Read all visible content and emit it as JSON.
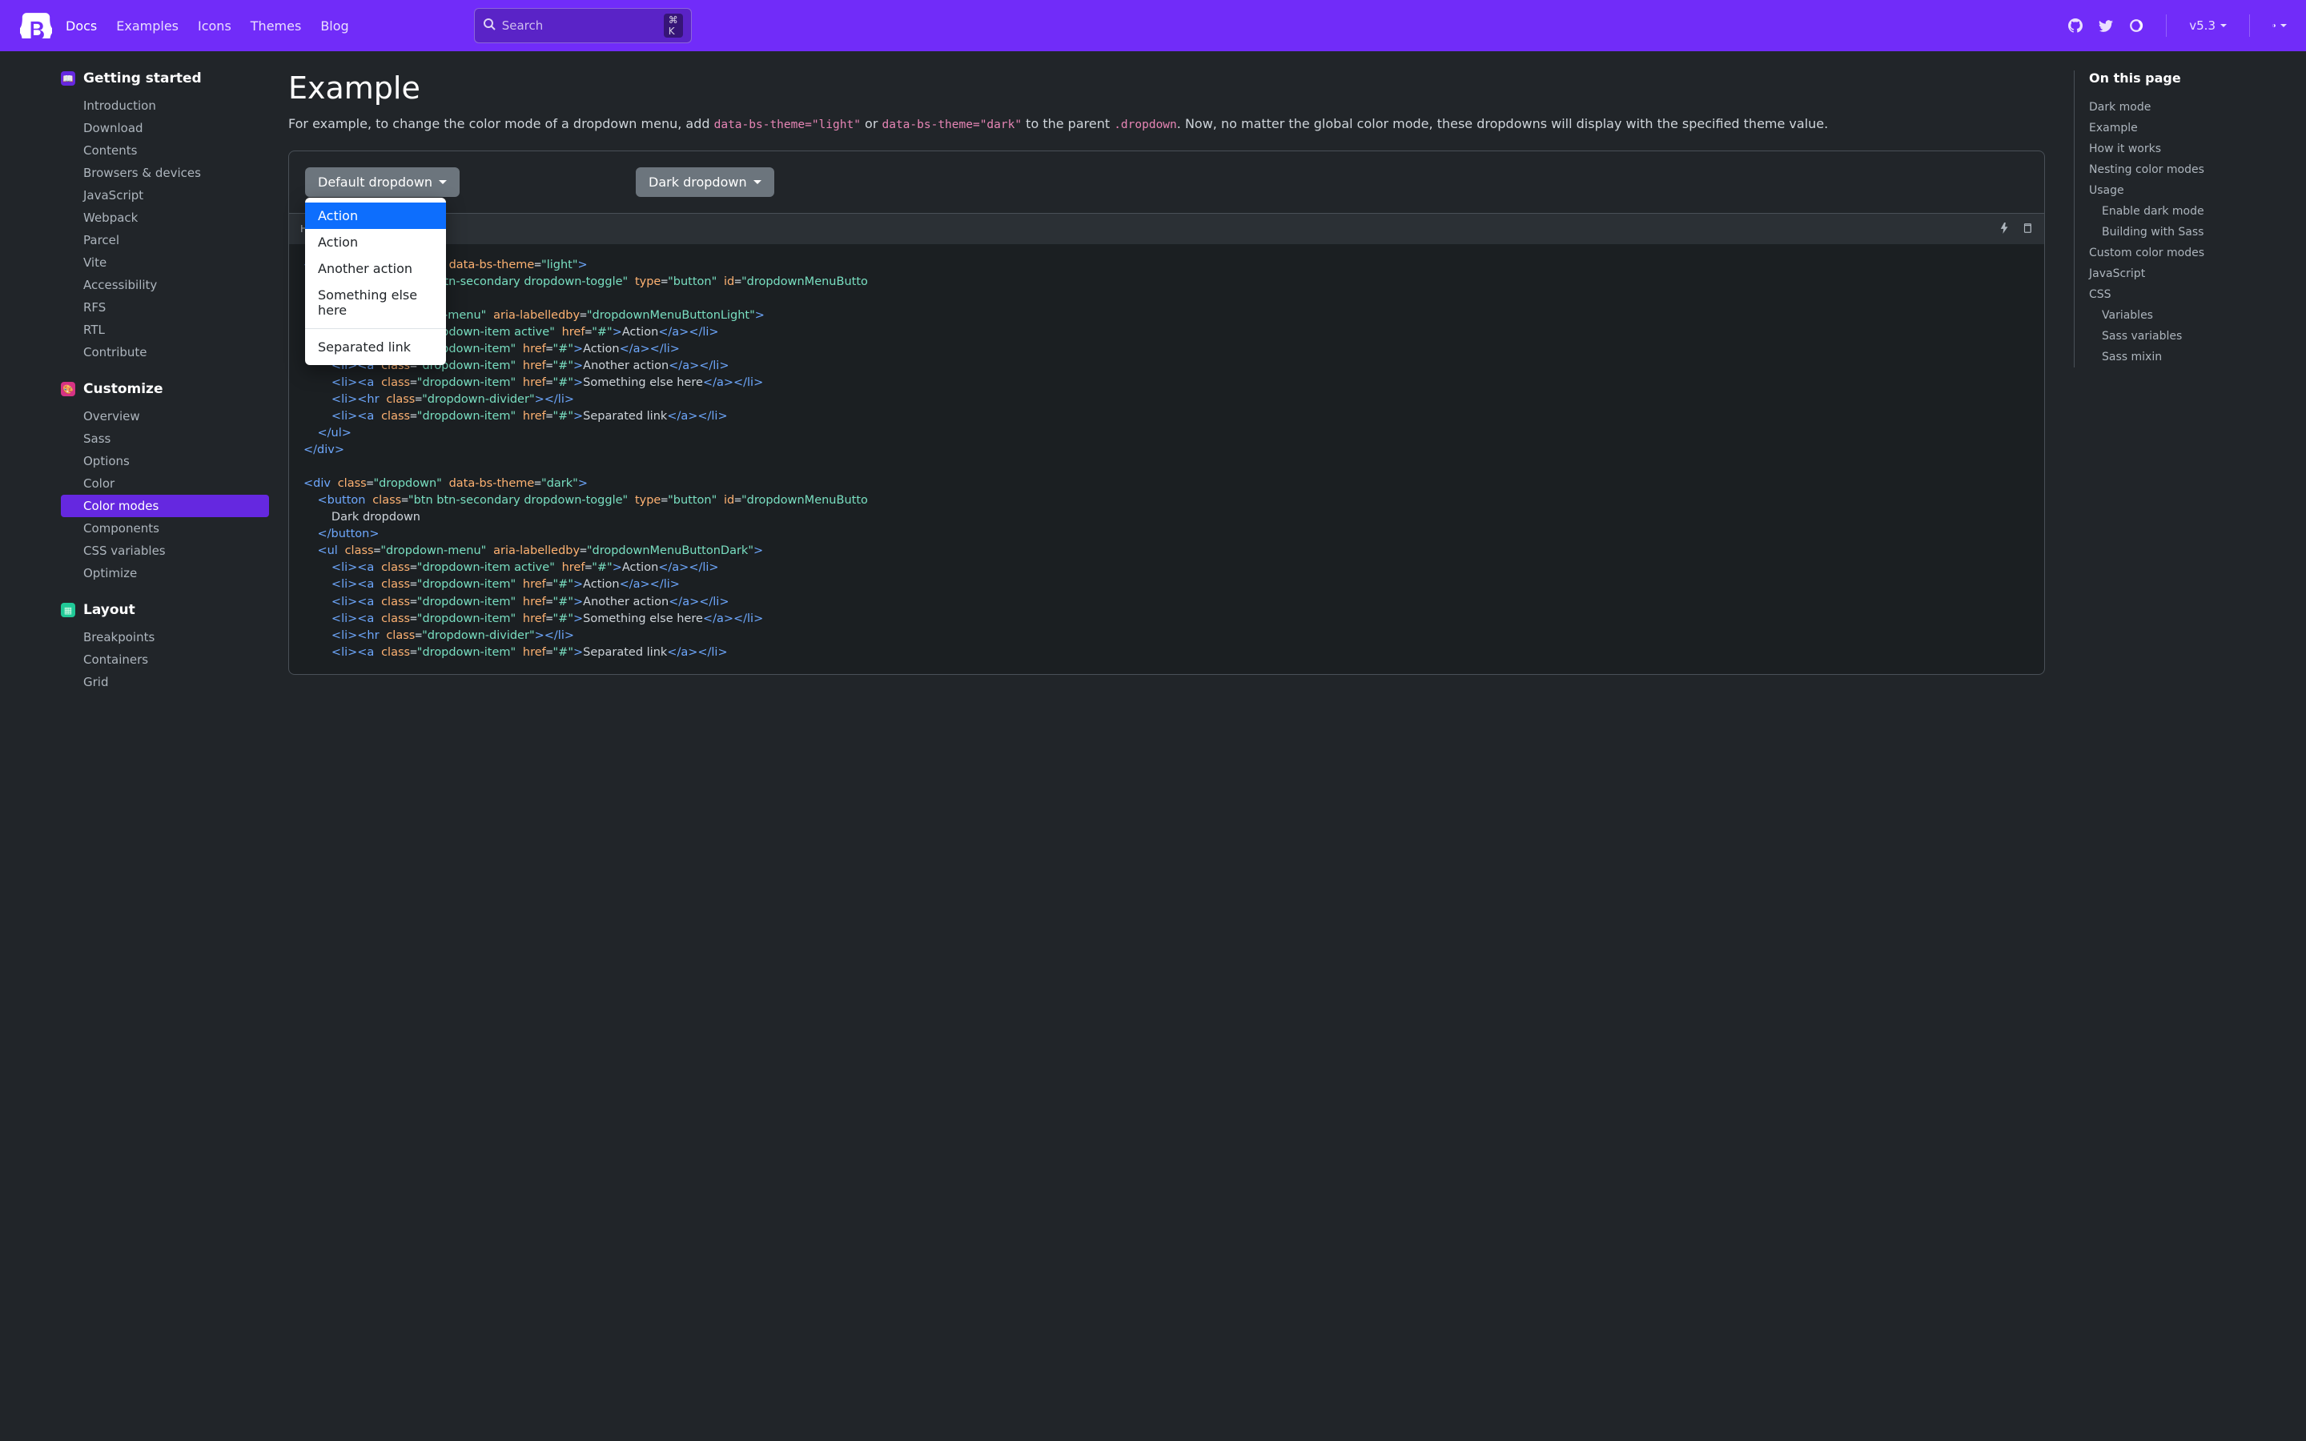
{
  "nav": {
    "items": [
      "Docs",
      "Examples",
      "Icons",
      "Themes",
      "Blog"
    ],
    "search_placeholder": "Search",
    "search_kbd": "⌘ K",
    "version": "v5.3"
  },
  "sidebar": {
    "sections": [
      {
        "title": "Getting started",
        "icon": "book",
        "color": "si-purple",
        "items": [
          "Introduction",
          "Download",
          "Contents",
          "Browsers & devices",
          "JavaScript",
          "Webpack",
          "Parcel",
          "Vite",
          "Accessibility",
          "RFS",
          "RTL",
          "Contribute"
        ]
      },
      {
        "title": "Customize",
        "icon": "palette",
        "color": "si-pink",
        "items": [
          "Overview",
          "Sass",
          "Options",
          "Color",
          "Color modes",
          "Components",
          "CSS variables",
          "Optimize"
        ],
        "activeIndex": 4
      },
      {
        "title": "Layout",
        "icon": "grid",
        "color": "si-teal",
        "items": [
          "Breakpoints",
          "Containers",
          "Grid"
        ]
      }
    ]
  },
  "main": {
    "heading": "Example",
    "para_pre": "For example, to change the color mode of a dropdown menu, add ",
    "code1": "data-bs-theme=\"light\"",
    "para_mid": " or ",
    "code2": "data-bs-theme=\"dark\"",
    "para_mid2": " to the parent ",
    "code3": ".dropdown",
    "para_post": ". Now, no matter the global color mode, these dropdowns will display with the specified theme value.",
    "btn1": "Default dropdown",
    "btn2": "Dark dropdown",
    "menu": [
      "Action",
      "Action",
      "Another action",
      "Something else here",
      "Separated link"
    ],
    "code_label": "H"
  },
  "toc": {
    "title": "On this page",
    "items": [
      {
        "label": "Dark mode"
      },
      {
        "label": "Example"
      },
      {
        "label": "How it works"
      },
      {
        "label": "Nesting color modes"
      },
      {
        "label": "Usage",
        "children": [
          "Enable dark mode",
          "Building with Sass"
        ]
      },
      {
        "label": "Custom color modes"
      },
      {
        "label": "JavaScript"
      },
      {
        "label": "CSS",
        "children": [
          "Variables",
          "Sass variables",
          "Sass mixin"
        ]
      }
    ]
  }
}
